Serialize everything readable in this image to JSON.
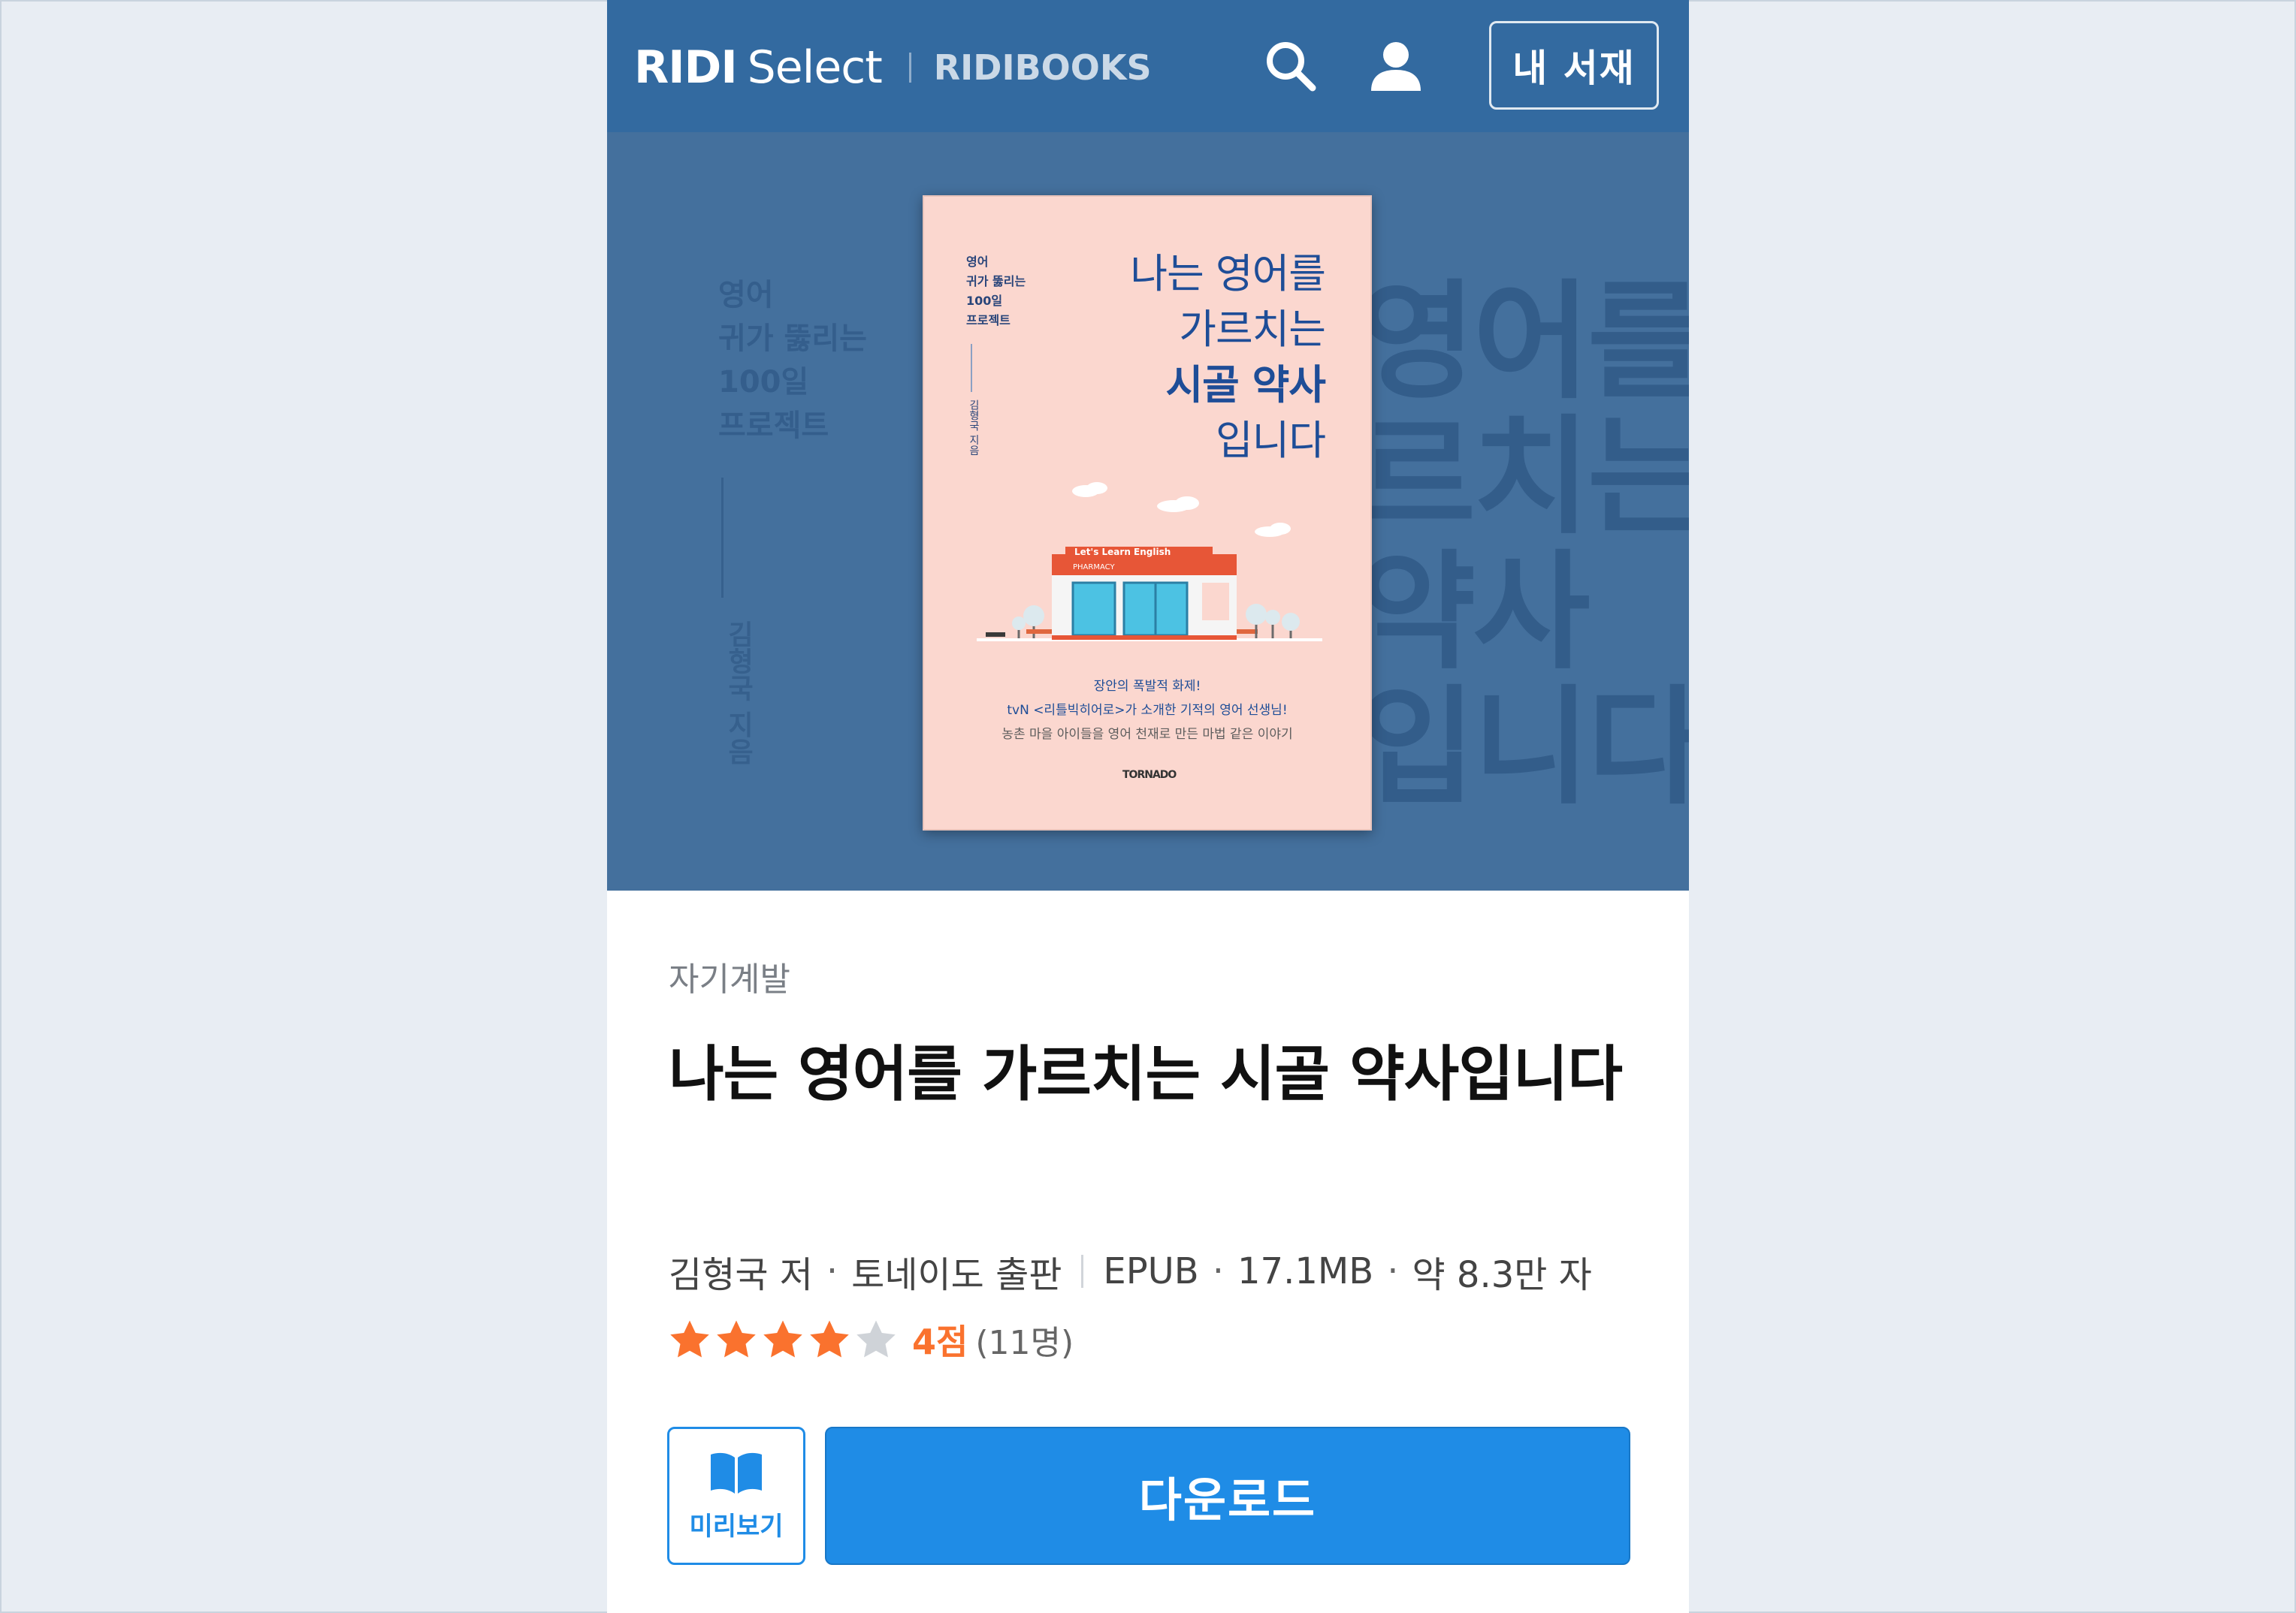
{
  "header": {
    "logo_ridi": "RIDI",
    "logo_select": "Select",
    "logo_books": "RIDIBOOKS",
    "my_library_label": "내 서재",
    "bg_color": "#336aa0"
  },
  "hero": {
    "bg_color": "#44709d",
    "bg_series": [
      "영어",
      "귀가 뚫리는",
      "100일",
      "프로젝트"
    ],
    "bg_author": "김형국 지음",
    "bg_title": [
      "영어를",
      "르치는",
      "약사",
      "입니다"
    ],
    "cover": {
      "series": [
        "영어",
        "귀가 뚫리는",
        "100일",
        "프로젝트"
      ],
      "author_vertical": "김형국 지음",
      "title_lines": [
        "나는 영어를",
        "가르치는",
        "시골 약사",
        "입니다"
      ],
      "sign_text": "Let's Learn English",
      "pharmacy_text": "PHARMACY",
      "blurb_1": "장안의 폭발적 화제!",
      "blurb_2": "tvN <리틀빅히어로>가 소개한 기적의 영어 선생님!",
      "blurb_3": "농촌 마을 아이들을 영어 천재로 만든 마법 같은 이야기",
      "publisher_logo": "TORNADO"
    }
  },
  "book": {
    "category": "자기계발",
    "title": "나는 영어를 가르치는 시골 약사입니다",
    "author": "김형국 저",
    "publisher": "토네이도 출판",
    "format": "EPUB",
    "file_size": "17.1MB",
    "length": "약 8.3만 자",
    "rating": 4,
    "rating_max": 5,
    "rating_label": "4점",
    "rating_count": "(11명)"
  },
  "actions": {
    "preview_label": "미리보기",
    "download_label": "다운로드",
    "accent_color": "#1f8ce6",
    "star_color": "#fa722e"
  },
  "icons": {
    "search": "search-icon",
    "user": "user-icon",
    "preview": "open-book-icon",
    "star": "star-icon"
  }
}
